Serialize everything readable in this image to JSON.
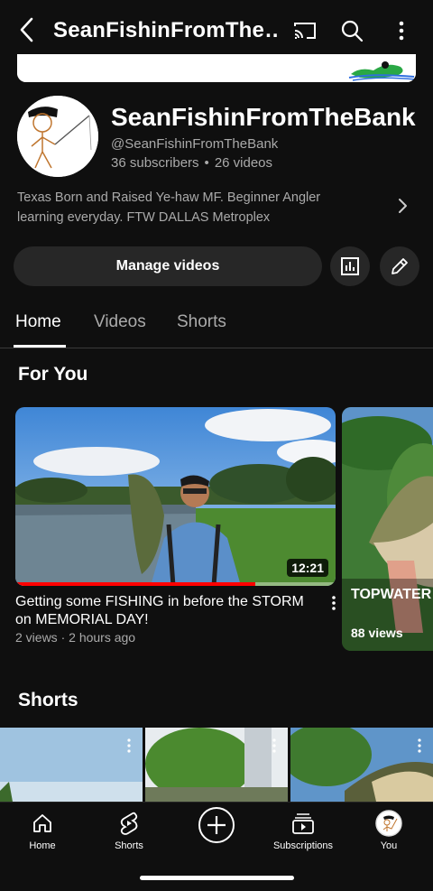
{
  "topbar": {
    "title": "SeanFishinFromThe…",
    "icons": [
      "back-icon",
      "cast-icon",
      "search-icon",
      "more-vert-icon"
    ]
  },
  "channel": {
    "name": "SeanFishinFromTheBank",
    "handle": "@SeanFishinFromTheBank",
    "subscribers": "36 subscribers",
    "videos": "26 videos",
    "separator": "•",
    "description": "Texas Born and Raised Ye-haw MF. Beginner Angler learning everyday. FTW DALLAS Metroplex"
  },
  "actions": {
    "manage_videos": "Manage videos",
    "icons": [
      "analytics-icon",
      "edit-icon"
    ]
  },
  "tabs": [
    {
      "label": "Home",
      "active": true
    },
    {
      "label": "Videos",
      "active": false
    },
    {
      "label": "Shorts",
      "active": false
    }
  ],
  "for_you": {
    "heading": "For You",
    "videos": [
      {
        "title": "Getting some FISHING in before the STORM on MEMORIAL DAY!",
        "views": "2 views",
        "age": "2 hours ago",
        "meta_separator": "·",
        "duration": "12:21",
        "watched_fraction": 0.75
      },
      {
        "title": "TOPWATER BLOWUP #",
        "views": "88 views"
      }
    ]
  },
  "shorts": {
    "heading": "Shorts"
  },
  "bottom_nav": [
    {
      "label": "Home",
      "icon": "home-icon"
    },
    {
      "label": "Shorts",
      "icon": "shorts-icon"
    },
    {
      "label": "",
      "icon": "create-icon"
    },
    {
      "label": "Subscriptions",
      "icon": "subscriptions-icon"
    },
    {
      "label": "You",
      "icon": "you-avatar-icon"
    }
  ],
  "colors": {
    "background": "#0f0f0f",
    "surface": "#272727",
    "text_secondary": "#aaaaaa",
    "accent_red": "#ff0000"
  }
}
